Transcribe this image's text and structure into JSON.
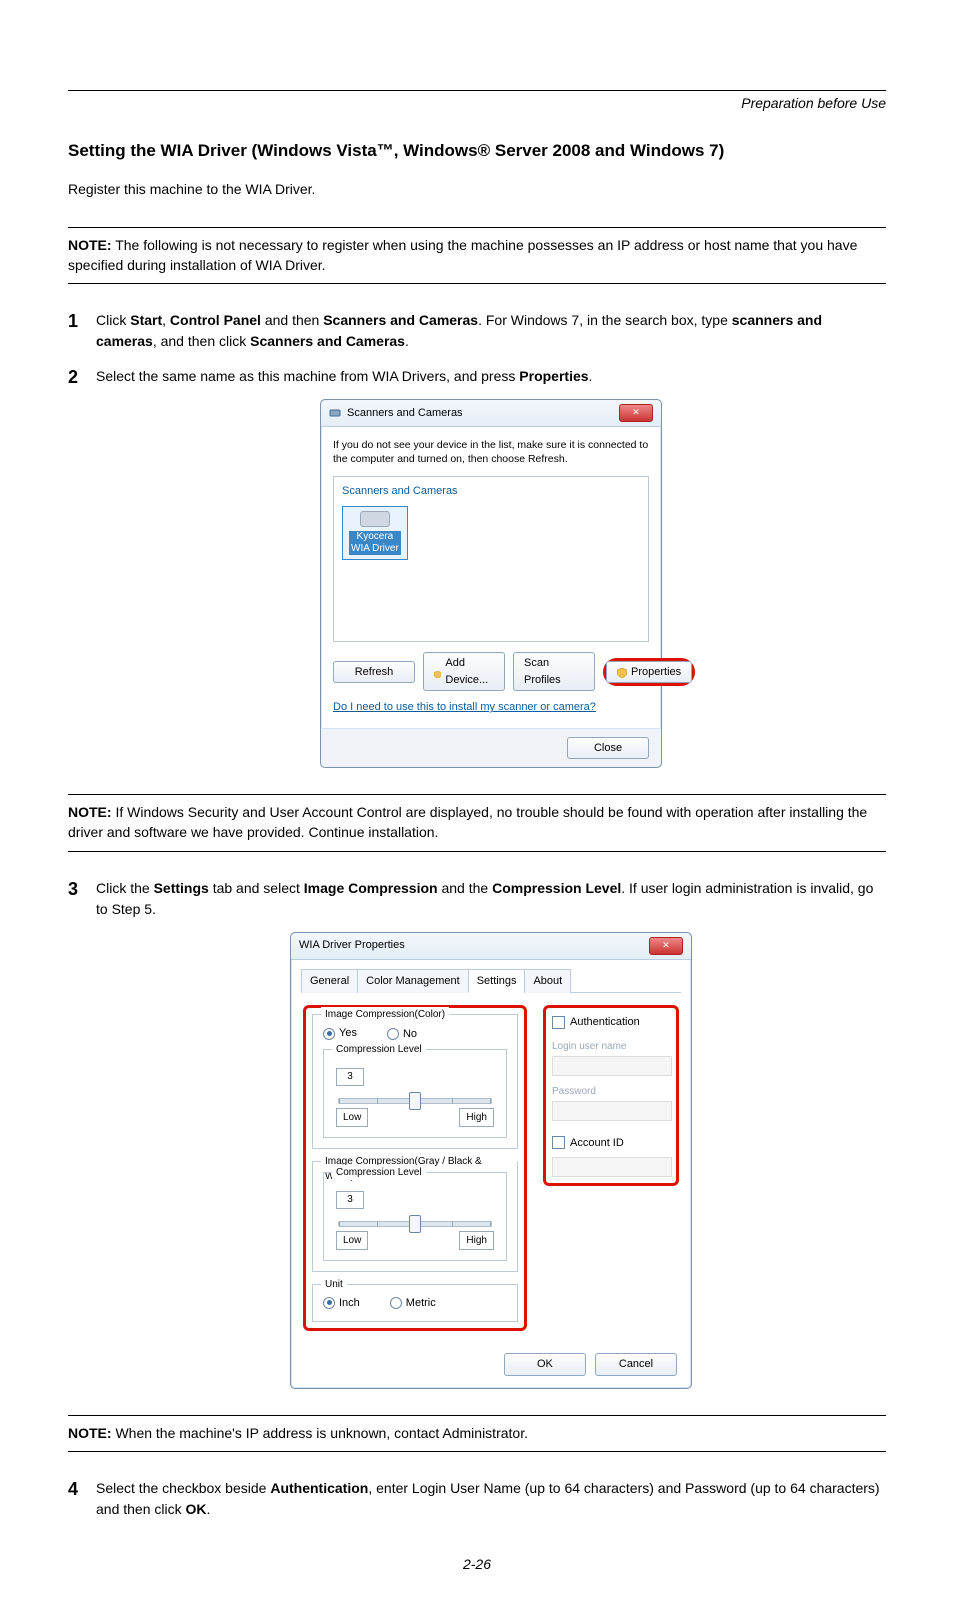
{
  "running_head": "Preparation before Use",
  "heading": "Setting the WIA Driver (Windows Vista™, Windows® Server 2008 and Windows 7)",
  "intro": "Register this machine to the WIA Driver.",
  "notes": {
    "n1_label": "NOTE:",
    "n1_text": " The following is not necessary to register when using the machine possesses an IP address or host name that you have specified during installation of WIA Driver.",
    "n2_label": "NOTE:",
    "n2_text": " If Windows Security and User Account Control are displayed, no trouble should be found with operation after installing the driver and software we have provided. Continue installation.",
    "n3_label": "NOTE:",
    "n3_text": " When the machine's IP address is unknown, contact Administrator."
  },
  "steps": {
    "s1": {
      "pre": "Click ",
      "b1": "Start",
      "sep1": ", ",
      "b2": "Control Panel",
      "mid1": " and then ",
      "b3": "Scanners and Cameras",
      "mid2": ". For Windows 7, in the search box, type ",
      "b4": "scanners and cameras",
      "mid3": ", and then click ",
      "b5": "Scanners and Cameras",
      "end": "."
    },
    "s2": {
      "text": "Select the same name as this machine from WIA Drivers, and press ",
      "b1": "Properties",
      "end": "."
    },
    "s3": {
      "pre": "Click the ",
      "b1": "Settings",
      "mid1": " tab and select ",
      "b2": "Image Compression",
      "mid2": " and the ",
      "b3": "Compression Level",
      "end": ". If user login administration is invalid, go to Step 5."
    },
    "s4": {
      "pre": "Select the checkbox beside ",
      "b1": "Authentication",
      "mid1": ", enter Login User Name (up to 64 characters) and Password (up to 64 characters) and then click ",
      "b2": "OK",
      "end": "."
    }
  },
  "dlg1": {
    "title": "Scanners and Cameras",
    "body_hint": "If you do not see your device in the list, make sure it is connected to the computer and turned on, then choose Refresh.",
    "group_legend": "Scanners and Cameras",
    "device_line1": "Kyocera",
    "device_line3": "WIA Driver",
    "btn_refresh": "Refresh",
    "btn_add": "Add Device...",
    "btn_scan": "Scan Profiles",
    "btn_props": "Properties",
    "help_link": "Do I need to use this to install my scanner or camera?",
    "btn_close": "Close"
  },
  "dlg2": {
    "title": "WIA Driver Properties",
    "tabs": [
      "General",
      "Color Management",
      "Settings",
      "About"
    ],
    "grp_color": "Image Compression(Color)",
    "radio_yes": "Yes",
    "radio_no": "No",
    "grp_level": "Compression Level",
    "level_val": "3",
    "low": "Low",
    "high": "High",
    "grp_gray": "Image Compression(Gray / Black & White)",
    "grp_unit": "Unit",
    "unit_inch": "Inch",
    "unit_metric": "Metric",
    "auth": "Authentication",
    "login_lbl": "Login user name",
    "pass_lbl": "Password",
    "acct": "Account ID",
    "ok": "OK",
    "cancel": "Cancel"
  },
  "page_num": "2-26"
}
